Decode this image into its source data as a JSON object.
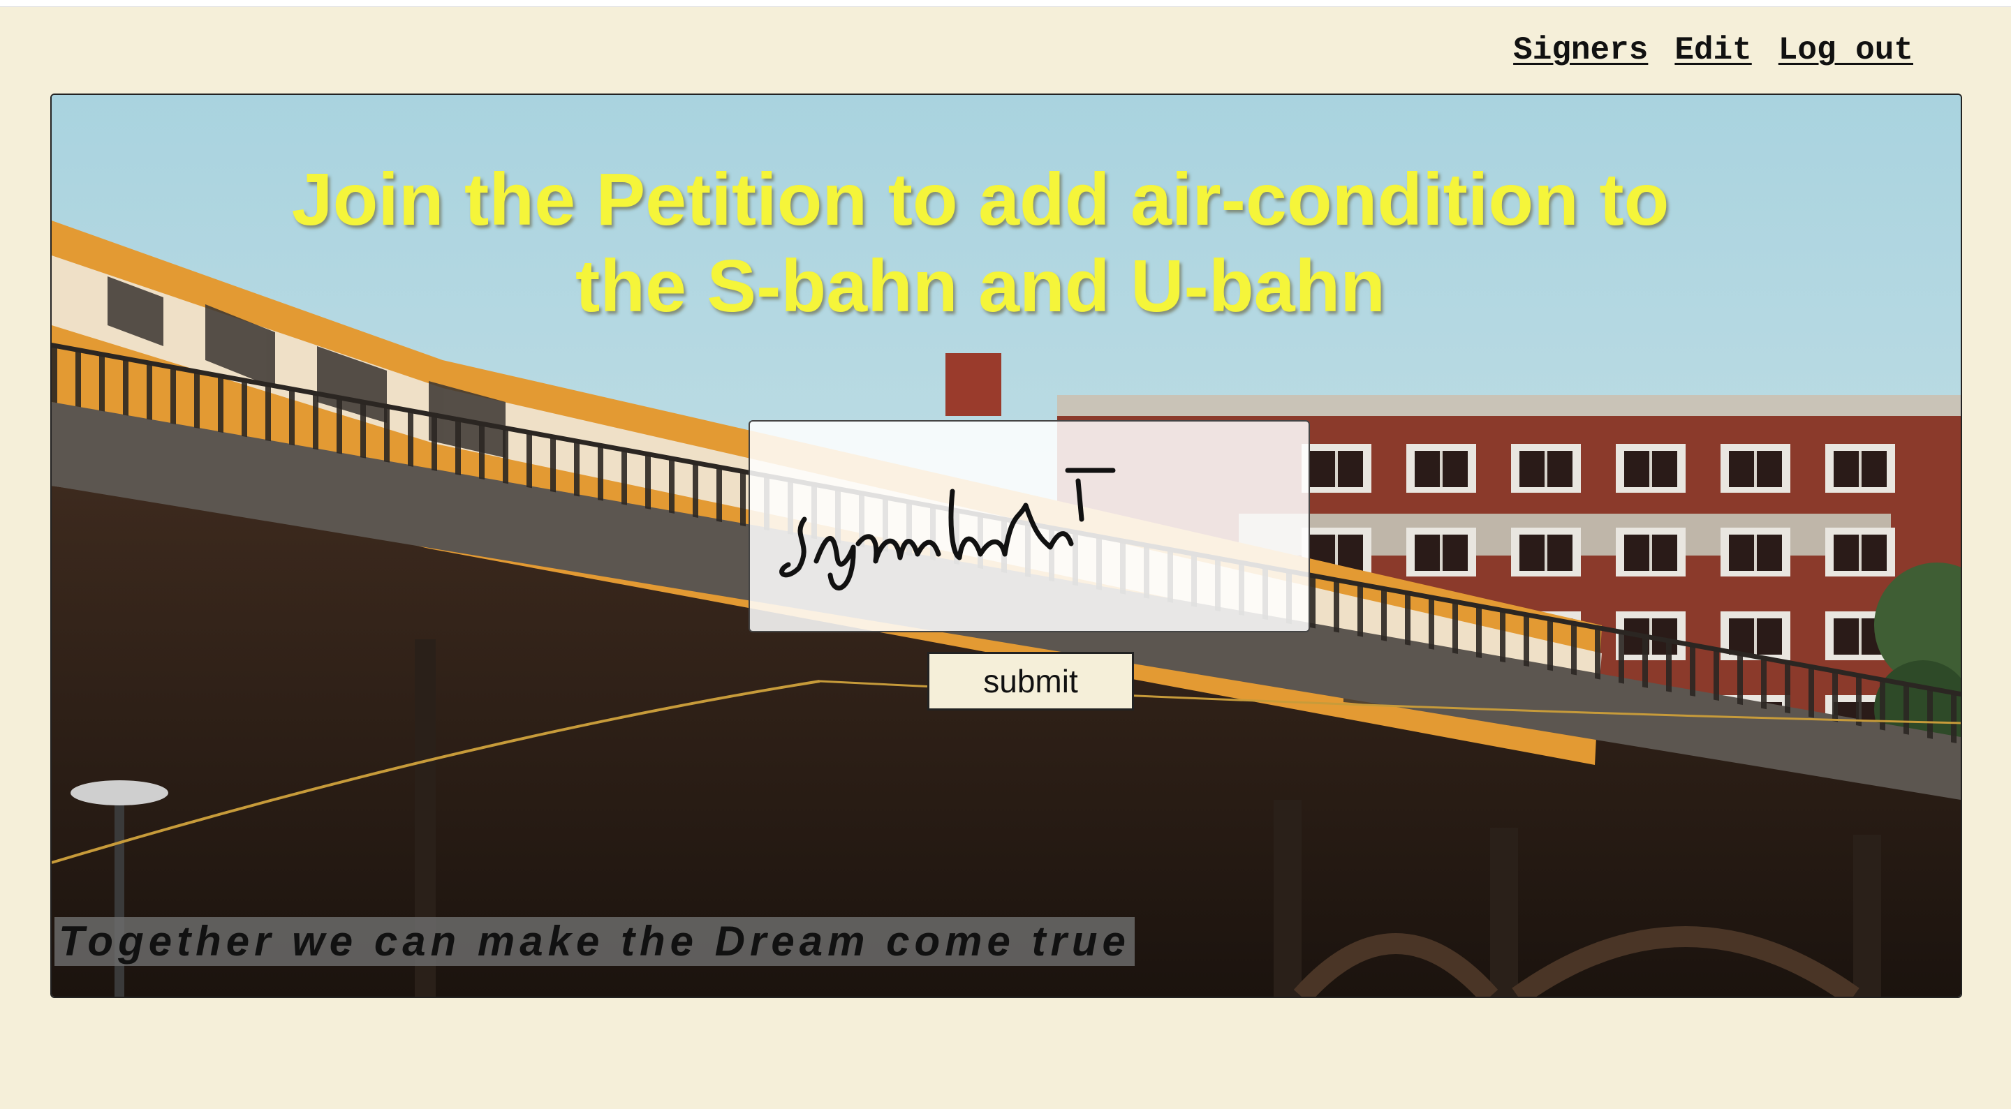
{
  "nav": {
    "signers": "Signers",
    "edit": "Edit",
    "logout": "Log out"
  },
  "hero": {
    "title": "Join the Petition to add air-condition to the S-bahn and U-bahn",
    "submit_label": "submit",
    "tagline": "Together we can make the Dream come true"
  },
  "signature": {
    "handwritten_text": "signature"
  },
  "colors": {
    "page_background": "#f5efd9",
    "title_yellow": "#f5f53a",
    "train_orange": "#e39a33",
    "brick_red": "#8b3a2b"
  }
}
